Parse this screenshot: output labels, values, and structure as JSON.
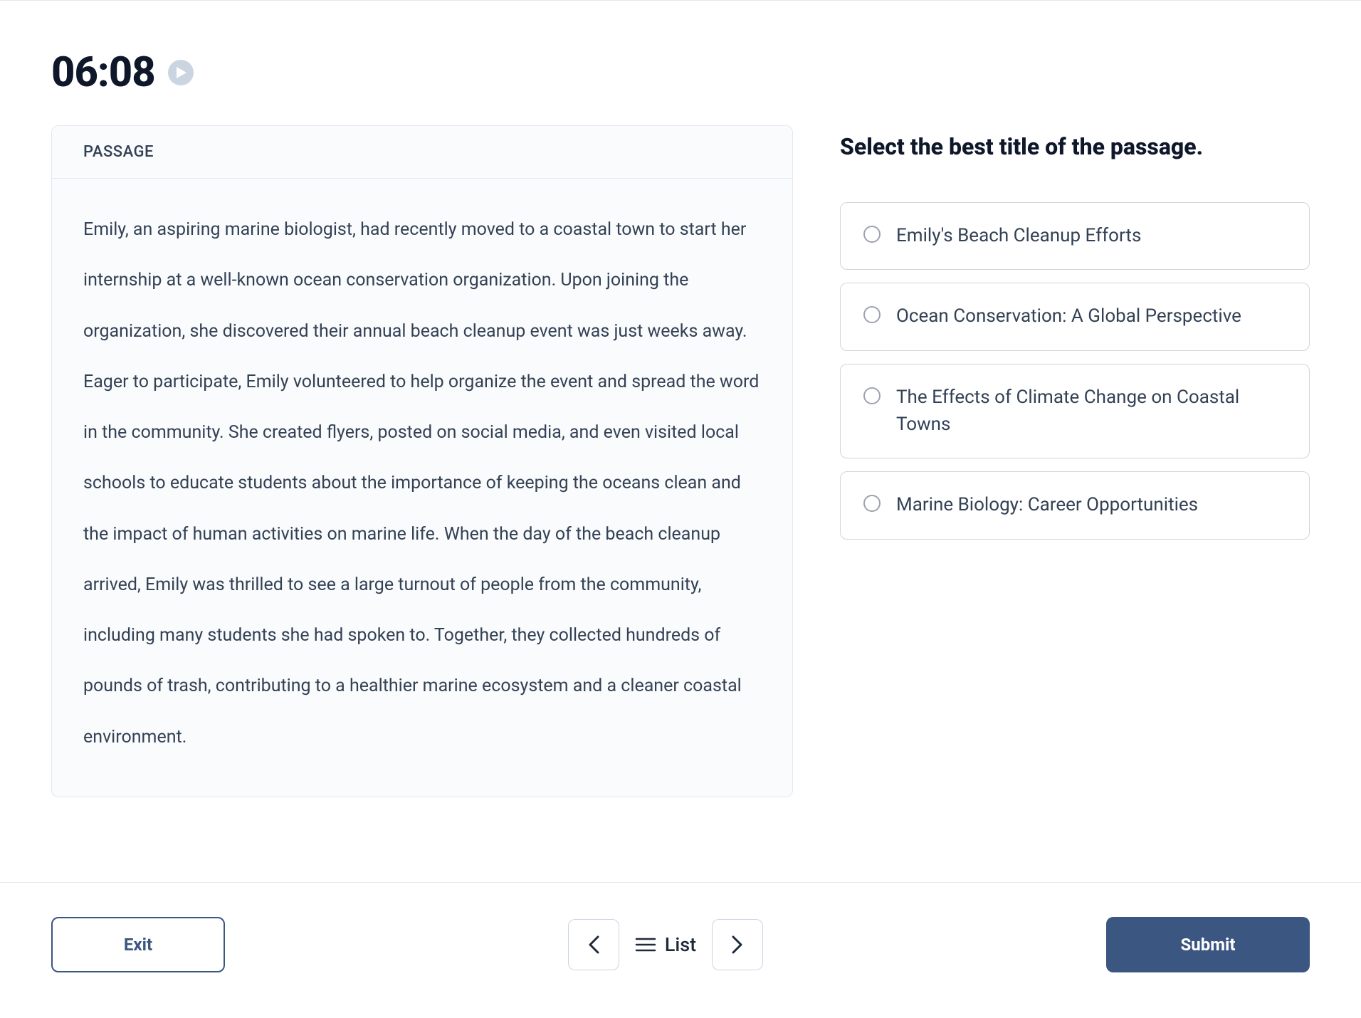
{
  "timer": "06:08",
  "passage": {
    "header": "PASSAGE",
    "text": "Emily, an aspiring marine biologist, had recently moved to a coastal town to start her internship at a well-known ocean conservation organization. Upon joining the organization, she discovered their annual beach cleanup event was just weeks away. Eager to participate, Emily volunteered to help organize the event and spread the word in the community. She created flyers, posted on social media, and even visited local schools to educate students about the importance of keeping the oceans clean and the impact of human activities on marine life. When the day of the beach cleanup arrived, Emily was thrilled to see a large turnout of people from the community, including many students she had spoken to. Together, they collected hundreds of pounds of trash, contributing to a healthier marine ecosystem and a cleaner coastal environment."
  },
  "question": "Select the best title of the passage.",
  "options": [
    "Emily's Beach Cleanup Efforts",
    "Ocean Conservation: A Global Perspective",
    "The Effects of Climate Change on Coastal Towns",
    "Marine Biology: Career Opportunities"
  ],
  "footer": {
    "exit": "Exit",
    "list": "List",
    "submit": "Submit"
  }
}
